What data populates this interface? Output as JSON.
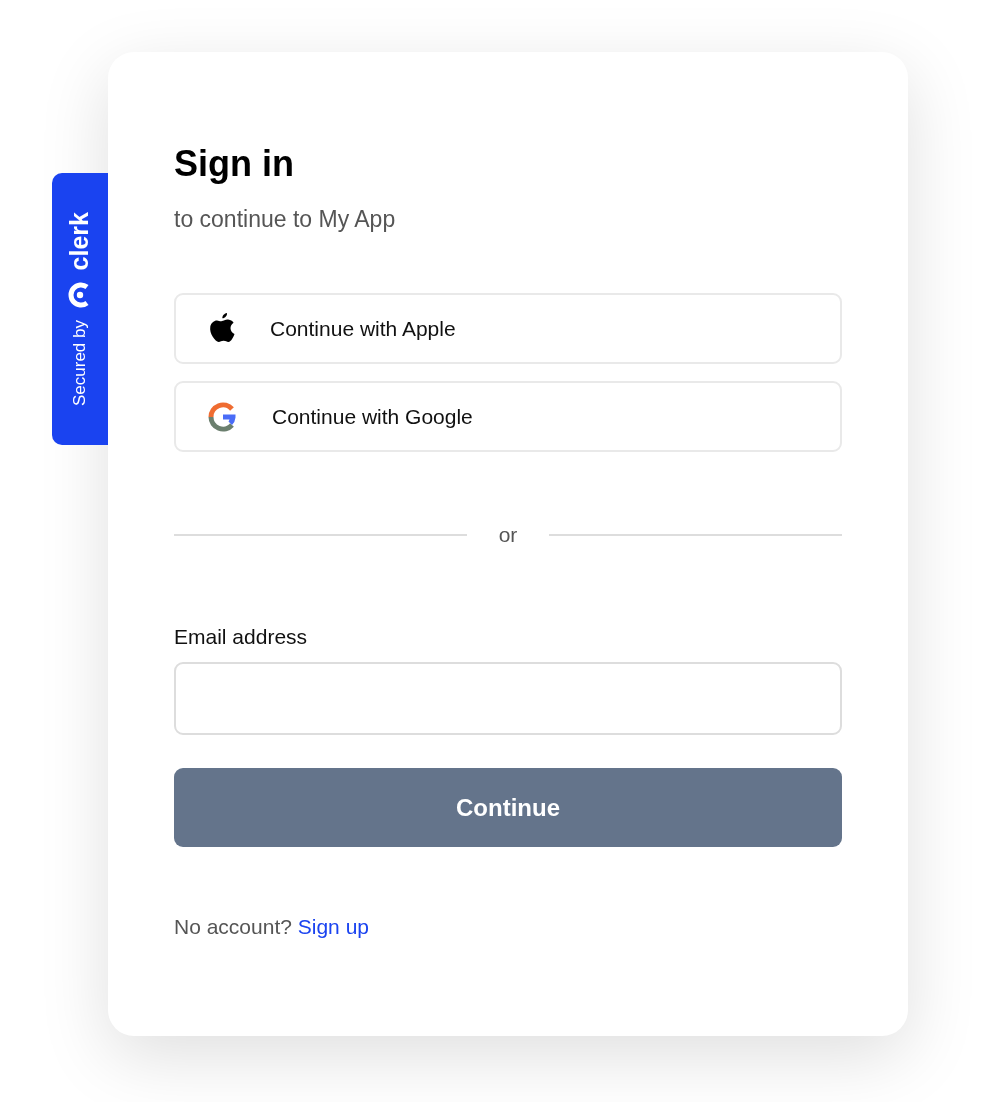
{
  "badge": {
    "label": "Secured by",
    "brand": "clerk"
  },
  "title": "Sign in",
  "subtitle": "to continue to My App",
  "social_buttons": [
    {
      "kind": "apple",
      "label": "Continue with Apple"
    },
    {
      "kind": "google",
      "label": "Continue with Google"
    }
  ],
  "divider": "or",
  "email_field": {
    "label": "Email address"
  },
  "submit_button": "Continue",
  "footer": {
    "text": "No account?",
    "link": "Sign up"
  }
}
